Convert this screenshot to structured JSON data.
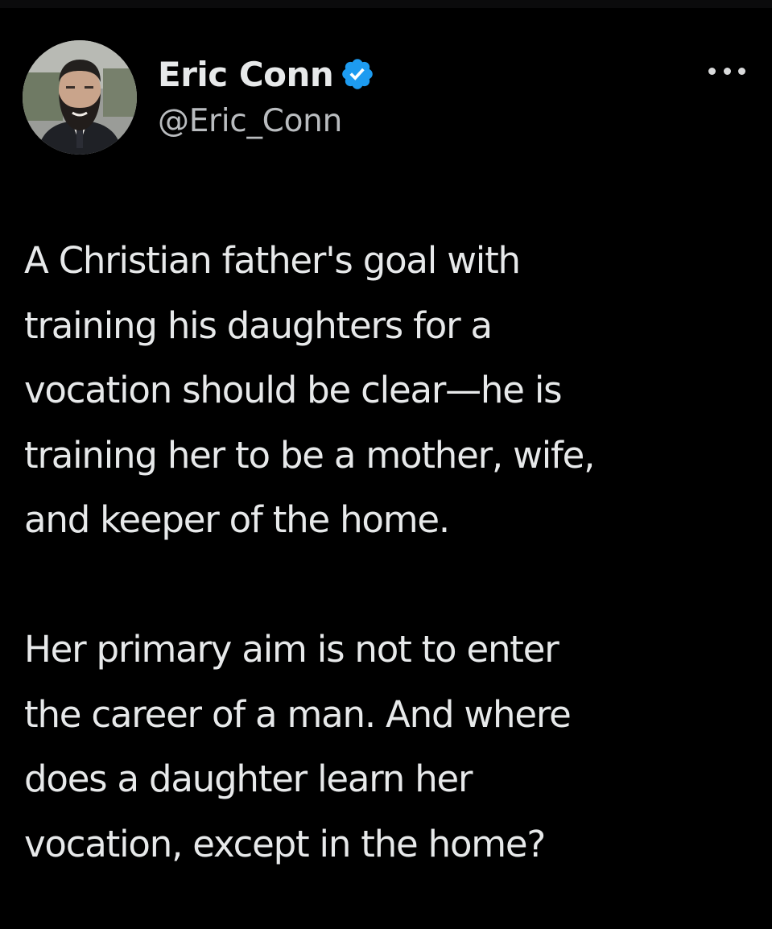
{
  "tweet": {
    "author": {
      "display_name": "Eric Conn",
      "handle": "@Eric_Conn",
      "verified_icon": "verified-badge-icon",
      "verified_color": "#1d9bf0"
    },
    "more_icon": "more-options-icon",
    "paragraphs": [
      "A Christian father's goal with\ntraining his daughters for a\nvocation should be clear—he is\ntraining her to be a mother, wife,\nand keeper of the home.",
      "Her primary aim is not to enter\nthe career of a man. And where\ndoes a daughter learn her\nvocation, except in the home?"
    ]
  },
  "colors": {
    "background": "#000000",
    "text_primary": "#e7e9ea",
    "text_secondary": "#b9bcbf",
    "accent": "#1d9bf0"
  }
}
